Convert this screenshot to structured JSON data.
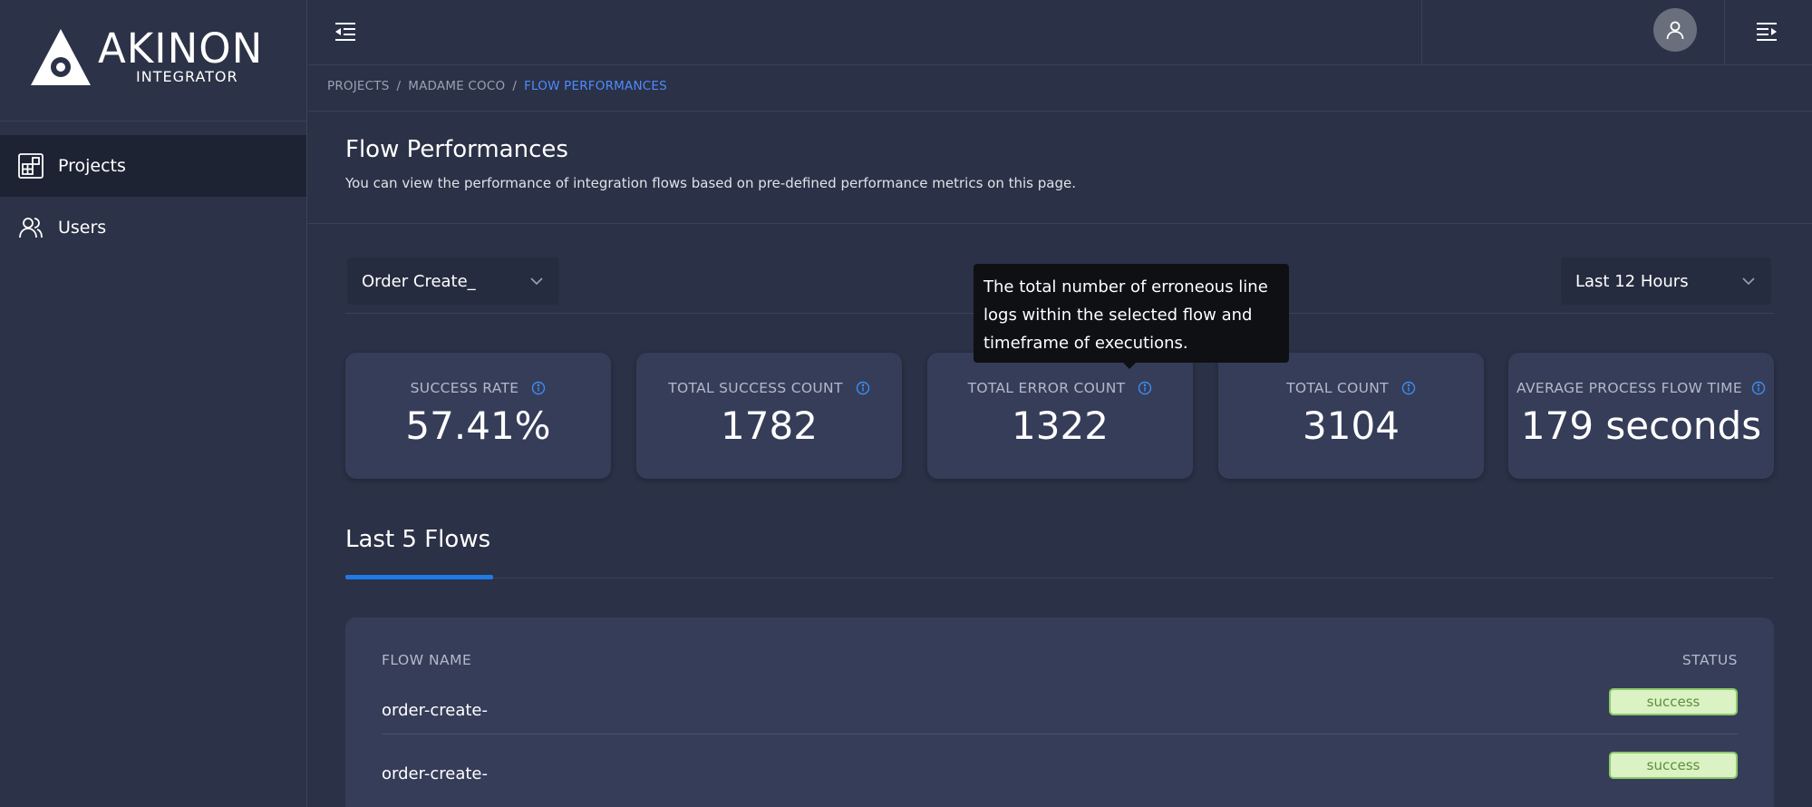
{
  "brand": {
    "name": "AKINON",
    "subtitle": "INTEGRATOR"
  },
  "sidebar": {
    "items": [
      {
        "label": "Projects",
        "icon": "projects-icon",
        "active": true
      },
      {
        "label": "Users",
        "icon": "users-icon",
        "active": false
      }
    ]
  },
  "breadcrumb": {
    "items": [
      "PROJECTS",
      "MADAME COCO",
      "FLOW PERFORMANCES"
    ],
    "separator": "/"
  },
  "page": {
    "title": "Flow Performances",
    "description": "You can view the performance of integration flows based on pre-defined performance metrics on this page."
  },
  "filters": {
    "flow": "Order Create_",
    "timeframe": "Last 12 Hours"
  },
  "tooltip": {
    "text": "The total number of erroneous line logs within the selected flow and timeframe of executions."
  },
  "metrics": [
    {
      "label": "SUCCESS RATE",
      "value": "57.41%"
    },
    {
      "label": "TOTAL SUCCESS COUNT",
      "value": "1782"
    },
    {
      "label": "TOTAL ERROR COUNT",
      "value": "1322"
    },
    {
      "label": "TOTAL COUNT",
      "value": "3104"
    },
    {
      "label": "AVERAGE PROCESS FLOW TIME",
      "value": "179 seconds"
    }
  ],
  "last_flows": {
    "tab_label": "Last 5 Flows",
    "columns": [
      "FLOW NAME",
      "STATUS"
    ],
    "rows": [
      {
        "name": "order-create-",
        "status": "success"
      },
      {
        "name": "order-create-",
        "status": "success"
      }
    ]
  },
  "colors": {
    "accent": "#1f7ae6",
    "breadcrumb_current": "#4d8cff",
    "success_bg": "#daf2c4",
    "success_text": "#5d8e3b"
  }
}
